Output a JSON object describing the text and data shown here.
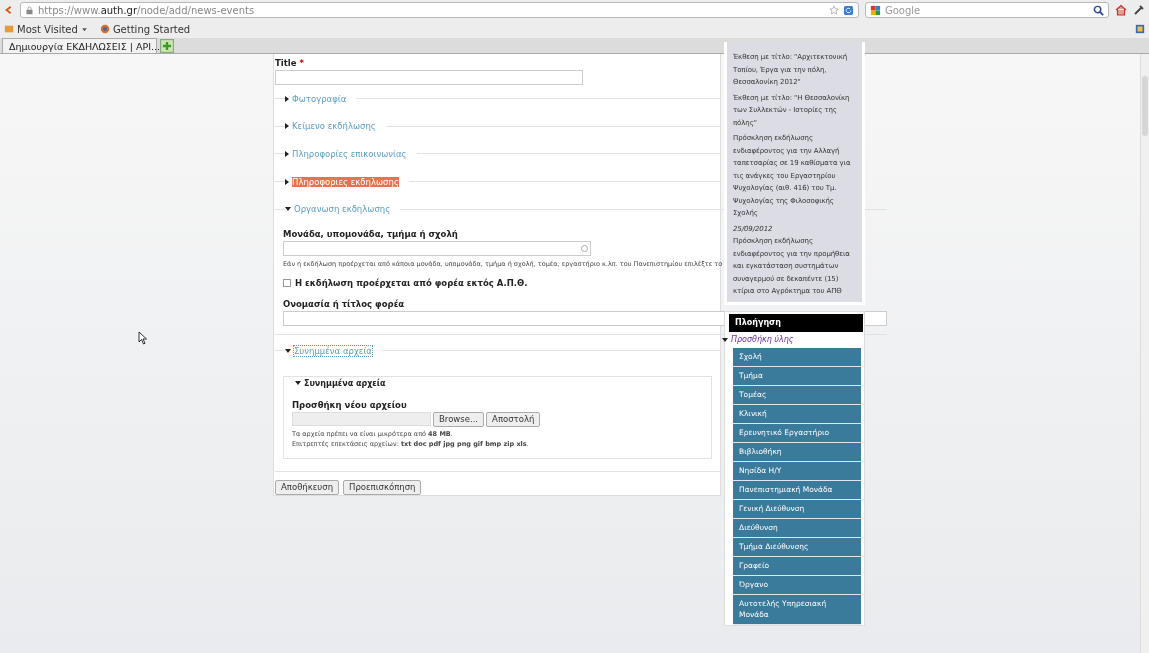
{
  "browser": {
    "url_prefix": "https://www.",
    "url_domain": "auth.gr",
    "url_path": "/node/add/news-events",
    "search_placeholder": "Google",
    "bookmarks": [
      "Most Visited",
      "Getting Started"
    ],
    "tab_title": "Δημιουργία ΕΚΔΗΛΩΣΕΙΣ | ΑΡΙ..."
  },
  "form": {
    "title_label": "Title",
    "required_mark": "*",
    "sections": [
      {
        "legend": "Φωτογραφία",
        "expanded": false,
        "highlighted": false
      },
      {
        "legend": "Κείμενο εκδήλωσης",
        "expanded": false,
        "highlighted": false
      },
      {
        "legend": "Πληροφορίες επικοινωνίας",
        "expanded": false,
        "highlighted": false
      },
      {
        "legend": "Πληροφοριες εκδηλωσης",
        "expanded": false,
        "highlighted": true
      }
    ],
    "organisation": {
      "legend": "Οργανωση εκδηλωσης",
      "expanded": true,
      "unit_label": "Μονάδα, υπομονάδα, τμήμα ή σχολή",
      "unit_help": "Εάν η εκδήλωση προέρχεται από κάποια μονάδα, υπομονάδα, τμήμα ή σχολή, τομέα, εργαστήριο κ.λπ. του Πανεπιστημίου επιλέξτε το",
      "external_label": "Η εκδήλωση προέρχεται από φορέα εκτός Α.Π.Θ.",
      "external_checked": false,
      "name_label": "Ονομασία ή τίτλος φορέα"
    },
    "attachments": {
      "legend": "Συνημμένα αρχεία",
      "expanded": true,
      "inner_legend": "Συνημμένα αρχεία",
      "inner_expanded": true,
      "new_file_label": "Προσθήκη νέου αρχείου",
      "browse": "Browse...",
      "upload": "Αποστολή",
      "size_note": "Τα αρχεία πρέπει να είναι μικρότερα από **48 MB**.",
      "ext_note": "Επιτρεπτές επεκτάσεις αρχείων: **txt doc pdf jpg png gif bmp zip xls**."
    },
    "buttons": [
      "Αποθήκευση",
      "Προεπισκόπηση"
    ]
  },
  "news": [
    {
      "text": "Έκθεση με τίτλο: \"Αρχιτεκτονική Τοπίου, Έργα για την πόλη, Θεσσαλονίκη 2012\""
    },
    {
      "text": "Έκθεση με τίτλο: \"Η Θεσσαλονίκη των Συλλεκτών - Ιστορίες της πόλης\""
    },
    {
      "text": "Πρόσκληση εκδήλωσης ενδιαφέροντος για την Αλλαγή ταπετσαρίας σε 19 καθίσματα για τις ανάγκες του Εργαστηρίου Ψυχολογίας (αιθ. 416) του Τμ. Ψυχολογίας της Φιλοσοφικής Σχολής"
    },
    {
      "date": "25/09/2012",
      "text": "Πρόσκληση εκδήλωσης ενδιαφέροντος για την προμήθεια και εγκατάσταση συστημάτων συναγερμού σε δεκαπέντε (15) κτίρια στο Αγρόκτημα του ΑΠΘ"
    }
  ],
  "navigation": {
    "title": "Πλοήγηση",
    "group": "Προσθήκη ύλης",
    "expanded": true,
    "items": [
      "Σχολή",
      "Τμήμα",
      "Τομέας",
      "Κλινική",
      "Ερευνητικό Εργαστήριο",
      "Βιβλιοθήκη",
      "Νησίδα Η/Υ",
      "Πανεπιστημιακή Μονάδα",
      "Γενική Διεύθυνση",
      "Διεύθυνση",
      "Τμήμα Διεύθυνσης",
      "Γραφείο",
      "Όργανο",
      "Αυτοτελής Υπηρεσιακή Μονάδα"
    ]
  }
}
